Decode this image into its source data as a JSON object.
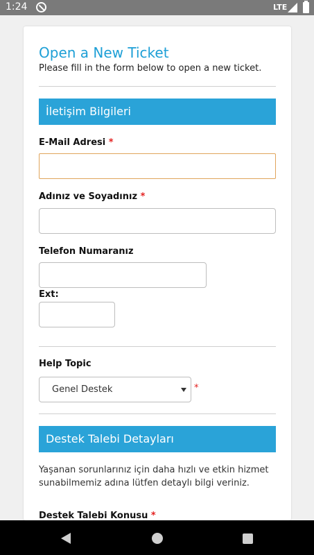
{
  "status_bar": {
    "time": "1:24",
    "network": "LTE",
    "icons": [
      "do-not-disturb-icon",
      "signal-icon",
      "battery-icon"
    ]
  },
  "form": {
    "title": "Open a New Ticket",
    "subtitle": "Please fill in the form below to open a new ticket.",
    "contact_section": "İletişim Bilgileri",
    "email_label": "E-Mail Adresi",
    "name_label": "Adınız ve Soyadınız",
    "phone_label": "Telefon Numaranız",
    "ext_label": "Ext:",
    "help_topic_label": "Help Topic",
    "help_topic_value": "Genel Destek",
    "details_section": "Destek Talebi Detayları",
    "details_description": "Yaşanan sorunlarınız için daha hızlı ve etkin hizmet sunabilmemiz adına lütfen detaylı bilgi veriniz.",
    "subject_label": "Destek Talebi Konusu",
    "required_mark": "*"
  },
  "colors": {
    "title": "#1d9fd6",
    "section_header": "#2aa3d8",
    "required": "#e3201f",
    "focused_border": "#e0a45a"
  }
}
